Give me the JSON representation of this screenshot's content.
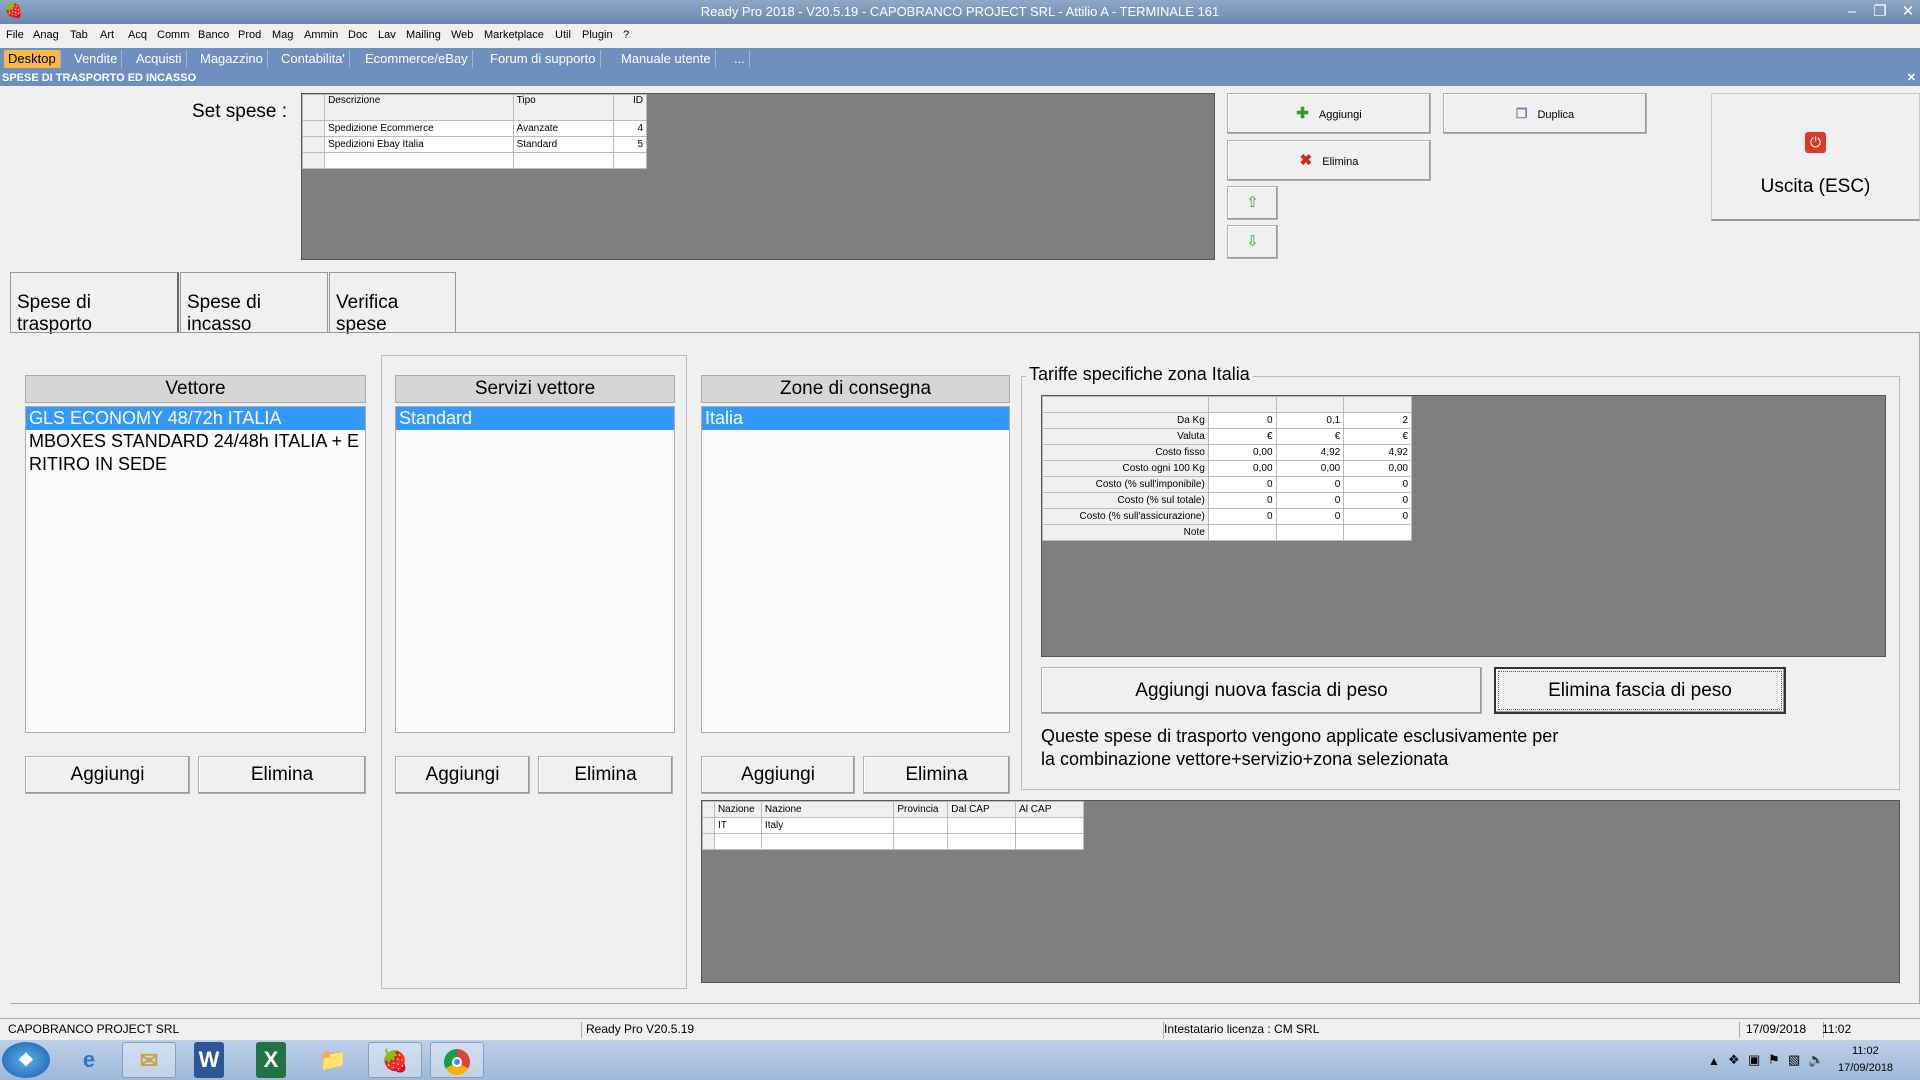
{
  "window": {
    "title": "Ready Pro 2018 - V20.5.19 - CAPOBRANCO PROJECT SRL - Attilio A - TERMINALE 161"
  },
  "menu": [
    "File",
    "Anag",
    "Tab",
    "Art",
    "Acq",
    "Comm",
    "Banco",
    "Prod",
    "Mag",
    "Ammin",
    "Doc",
    "Lav",
    "Mailing",
    "Web",
    "Marketplace",
    "Util",
    "Plugin",
    "?"
  ],
  "tabs": [
    "Desktop",
    "Vendite",
    "Acquisti",
    "Magazzino",
    "Contabilita'",
    "Ecommerce/eBay",
    "Forum di supporto",
    "Manuale utente",
    "..."
  ],
  "subtitle": "SPESE DI TRASPORTO ED INCASSO",
  "set_spese": {
    "label": "Set spese :",
    "headers": [
      "Descrizione",
      "Tipo",
      "ID"
    ],
    "rows": [
      [
        "Spedizione Ecommerce",
        "Avanzate",
        "4"
      ],
      [
        "Spedizioni Ebay Italia",
        "Standard",
        "5"
      ]
    ]
  },
  "actions": {
    "add": "Aggiungi",
    "duplicate": "Duplica",
    "delete": "Elimina",
    "exit": "Uscita (ESC)"
  },
  "panel_tabs": [
    "Spese di trasporto",
    "Spese di incasso",
    "Verifica spese"
  ],
  "vettore": {
    "header": "Vettore",
    "items": [
      "GLS  ECONOMY 48/72h ITALIA",
      "MBOXES  STANDARD 24/48h ITALIA + E",
      "RITIRO IN SEDE"
    ],
    "add": "Aggiungi",
    "delete": "Elimina"
  },
  "servizi": {
    "header": "Servizi vettore",
    "items": [
      "Standard"
    ],
    "add": "Aggiungi",
    "delete": "Elimina"
  },
  "zone": {
    "header": "Zone di consegna",
    "items": [
      "Italia"
    ],
    "add": "Aggiungi",
    "delete": "Elimina",
    "table_headers": [
      "Nazione",
      "Nazione",
      "Provincia",
      "Dal CAP",
      "Al CAP"
    ],
    "table_rows": [
      [
        "IT",
        "Italy",
        "",
        "",
        ""
      ]
    ]
  },
  "tariffe": {
    "title": "Tariffe specifiche zona Italia",
    "rows": [
      {
        "label": "Da Kg",
        "values": [
          "0",
          "0,1",
          "2"
        ]
      },
      {
        "label": "Valuta",
        "values": [
          "€",
          "€",
          "€"
        ]
      },
      {
        "label": "Costo fisso",
        "values": [
          "0,00",
          "4,92",
          "4,92"
        ]
      },
      {
        "label": "Costo ogni 100 Kg",
        "values": [
          "0,00",
          "0,00",
          "0,00"
        ]
      },
      {
        "label": "Costo (% sull'imponibile)",
        "values": [
          "0",
          "0",
          "0"
        ]
      },
      {
        "label": "Costo (% sul totale)",
        "values": [
          "0",
          "0",
          "0"
        ]
      },
      {
        "label": "Costo (% sull'assicurazione)",
        "values": [
          "0",
          "0",
          "0"
        ]
      },
      {
        "label": "Note",
        "values": [
          "",
          "",
          ""
        ]
      }
    ],
    "add_band": "Aggiungi nuova fascia di peso",
    "delete_band": "Elimina fascia di peso",
    "note": "Queste spese di trasporto vengono applicate esclusivamente per la combinazione vettore+servizio+zona selezionata"
  },
  "status": {
    "company": "CAPOBRANCO PROJECT SRL",
    "version": "Ready Pro V20.5.19",
    "license": "Intestatario licenza : CM SRL",
    "date": "17/09/2018",
    "time": "11:02"
  },
  "taskbar": {
    "time": "11:02",
    "date": "17/09/2018"
  }
}
